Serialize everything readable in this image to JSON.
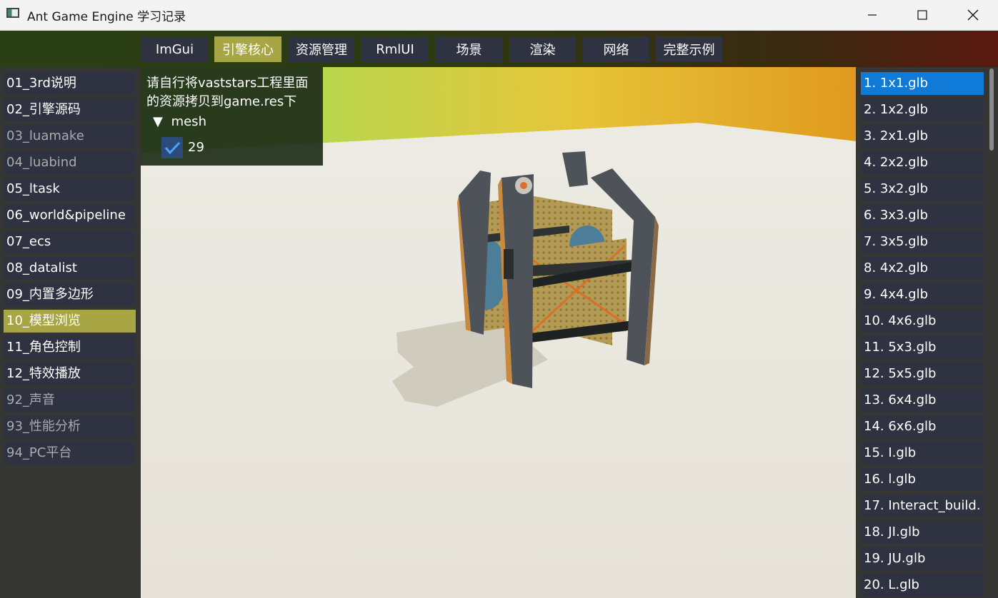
{
  "window": {
    "title": "Ant Game Engine 学习记录"
  },
  "tabs": [
    {
      "label": "ImGui",
      "active": false
    },
    {
      "label": "引擎核心",
      "active": true
    },
    {
      "label": "资源管理",
      "active": false
    },
    {
      "label": "RmlUI",
      "active": false
    },
    {
      "label": "场景",
      "active": false
    },
    {
      "label": "渲染",
      "active": false
    },
    {
      "label": "网络",
      "active": false
    },
    {
      "label": "完整示例",
      "active": false
    }
  ],
  "left_items": [
    {
      "label": "01_3rd说明",
      "state": "normal"
    },
    {
      "label": "02_引擎源码",
      "state": "normal"
    },
    {
      "label": "03_luamake",
      "state": "dim"
    },
    {
      "label": "04_luabind",
      "state": "dim"
    },
    {
      "label": "05_ltask",
      "state": "normal"
    },
    {
      "label": "06_world&pipeline",
      "state": "normal"
    },
    {
      "label": "07_ecs",
      "state": "normal"
    },
    {
      "label": "08_datalist",
      "state": "normal"
    },
    {
      "label": "09_内置多边形",
      "state": "normal"
    },
    {
      "label": "10_模型浏览",
      "state": "active"
    },
    {
      "label": "11_角色控制",
      "state": "normal"
    },
    {
      "label": "12_特效播放",
      "state": "normal"
    },
    {
      "label": "92_声音",
      "state": "dim"
    },
    {
      "label": "93_性能分析",
      "state": "dim"
    },
    {
      "label": "94_PC平台",
      "state": "dim"
    }
  ],
  "overlay": {
    "line1": "请自行将vaststars工程里面",
    "line2": "的资源拷贝到game.res下",
    "tree_arrow": "▼",
    "tree_label": "mesh",
    "checkbox_checked": true,
    "checkbox_label": "29"
  },
  "right_items": [
    {
      "label": "1. 1x1.glb",
      "active": true
    },
    {
      "label": "2. 1x2.glb",
      "active": false
    },
    {
      "label": "3. 2x1.glb",
      "active": false
    },
    {
      "label": "4. 2x2.glb",
      "active": false
    },
    {
      "label": "5. 3x2.glb",
      "active": false
    },
    {
      "label": "6. 3x3.glb",
      "active": false
    },
    {
      "label": "7. 3x5.glb",
      "active": false
    },
    {
      "label": "8. 4x2.glb",
      "active": false
    },
    {
      "label": "9. 4x4.glb",
      "active": false
    },
    {
      "label": "10. 4x6.glb",
      "active": false
    },
    {
      "label": "11. 5x3.glb",
      "active": false
    },
    {
      "label": "12. 5x5.glb",
      "active": false
    },
    {
      "label": "13. 6x4.glb",
      "active": false
    },
    {
      "label": "14. 6x6.glb",
      "active": false
    },
    {
      "label": "15. I.glb",
      "active": false
    },
    {
      "label": "16. l.glb",
      "active": false
    },
    {
      "label": "17. Interact_build.",
      "active": false
    },
    {
      "label": "18. JI.glb",
      "active": false
    },
    {
      "label": "19. JU.glb",
      "active": false
    },
    {
      "label": "20. L.glb",
      "active": false
    }
  ],
  "scene": {
    "sky_colors": [
      "#98e35a",
      "#e6c53a",
      "#e09a1e"
    ],
    "floor_color": "#e9e6dd",
    "model_description_icon": "cube-model"
  }
}
